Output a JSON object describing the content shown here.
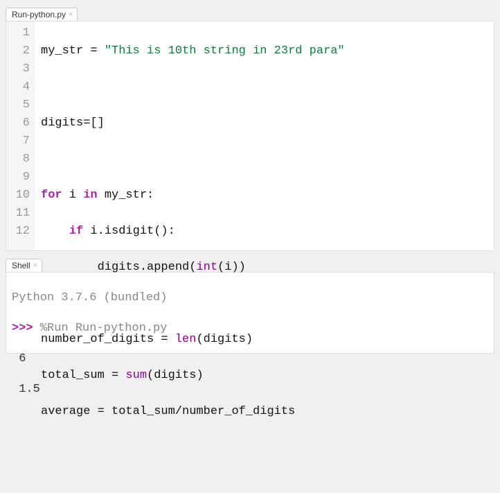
{
  "editor": {
    "tab_label": "Run-python.py",
    "lines": [
      1,
      2,
      3,
      4,
      5,
      6,
      7,
      8,
      9,
      10,
      11,
      12
    ],
    "code": {
      "l1_a": "my_str = ",
      "l1_b": "\"This is 10th string in 23rd para\"",
      "l2": "",
      "l3": "digits=[]",
      "l4": "",
      "l5_a": "for",
      "l5_b": " i ",
      "l5_c": "in",
      "l5_d": " my_str:",
      "l6_a": "    ",
      "l6_b": "if",
      "l6_c": " i.isdigit():",
      "l7_a": "        digits.append(",
      "l7_b": "int",
      "l7_c": "(i))",
      "l8": "",
      "l9_a": "number_of_digits = ",
      "l9_b": "len",
      "l9_c": "(digits)",
      "l10_a": "total_sum = ",
      "l10_b": "sum",
      "l10_c": "(digits)",
      "l11": "average = total_sum/number_of_digits",
      "l12": ""
    }
  },
  "shell": {
    "tab_label": "Shell",
    "version_line": "Python 3.7.6 (bundled)",
    "prompt": ">>> ",
    "run_cmd": "%Run Run-python.py",
    "output1": " 6",
    "output2": " 1.5"
  }
}
